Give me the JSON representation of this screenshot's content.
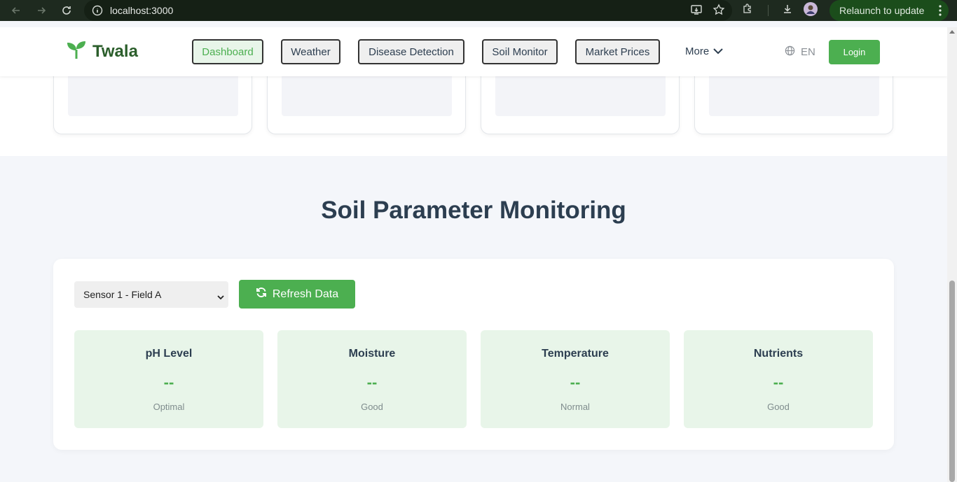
{
  "browser": {
    "url": "localhost:3000",
    "relaunch_label": "Relaunch to update",
    "icons": [
      "back-icon",
      "forward-icon",
      "reload-icon",
      "site-info-icon",
      "install-app-icon",
      "bookmark-star-icon",
      "extensions-icon",
      "download-icon",
      "profile-avatar",
      "more-menu-icon"
    ]
  },
  "header": {
    "brand": "Twala",
    "nav": [
      "Dashboard",
      "Weather",
      "Disease Detection",
      "Soil Monitor",
      "Market Prices"
    ],
    "active_nav": "Dashboard",
    "more_label": "More",
    "lang_label": "EN",
    "login_label": "Login"
  },
  "soil": {
    "title": "Soil Parameter Monitoring",
    "sensor_selected": "Sensor 1 - Field A",
    "refresh_label": "Refresh Data",
    "metrics": [
      {
        "label": "pH Level",
        "value": "--",
        "status": "Optimal"
      },
      {
        "label": "Moisture",
        "value": "--",
        "status": "Good"
      },
      {
        "label": "Temperature",
        "value": "--",
        "status": "Normal"
      },
      {
        "label": "Nutrients",
        "value": "--",
        "status": "Good"
      }
    ]
  },
  "colors": {
    "accent": "#4caf50",
    "brand_text": "#2b5e2b",
    "heading": "#2c3e50",
    "metric_bg": "#e8f5e9"
  }
}
